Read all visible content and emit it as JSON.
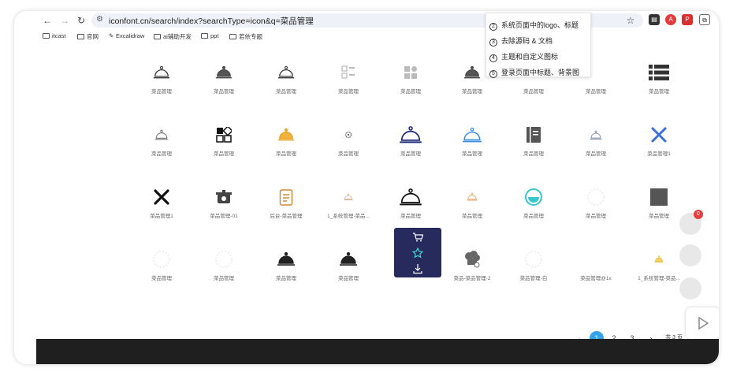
{
  "browser": {
    "url": "iconfont.cn/search/index?searchType=icon&q=菜品管理",
    "bookmarks": [
      "itcast",
      "官网",
      "Excalidraw",
      "ai辅助开发",
      "ppt",
      "若依专题"
    ]
  },
  "popup_menu": [
    {
      "num": "②",
      "label": "系统页面中的logo、标题"
    },
    {
      "num": "③",
      "label": "去除源码 & 文档"
    },
    {
      "num": "④",
      "label": "主题和自定义图标"
    },
    {
      "num": "⑤",
      "label": "登录页面中标题、背景图"
    }
  ],
  "icons": [
    {
      "label": "菜品管理",
      "icon": "cloche-outline-icon"
    },
    {
      "label": "菜品管理",
      "icon": "cloche-filled-icon"
    },
    {
      "label": "菜品管理",
      "icon": "cloche-outline-icon"
    },
    {
      "label": "菜品管理",
      "icon": "grid-list-icon"
    },
    {
      "label": "菜品管理",
      "icon": "grid-shapes-icon"
    },
    {
      "label": "菜品管理",
      "icon": "cloche-filled-icon"
    },
    {
      "label": "菜品管理",
      "icon": "hidden-icon"
    },
    {
      "label": "菜品管理",
      "icon": "hidden-icon"
    },
    {
      "label": "菜品管理",
      "icon": "list-icon"
    },
    {
      "label": "菜品管理",
      "icon": "cloche-thin-icon"
    },
    {
      "label": "菜品管理",
      "icon": "apps-icon"
    },
    {
      "label": "菜品管理",
      "icon": "cloche-yellow-icon"
    },
    {
      "label": "菜品管理",
      "icon": "gear-small-icon"
    },
    {
      "label": "菜品管理",
      "icon": "cloche-navy-icon"
    },
    {
      "label": "菜品管理",
      "icon": "cloche-blue-icon"
    },
    {
      "label": "菜品管理",
      "icon": "book-icon"
    },
    {
      "label": "菜品管理",
      "icon": "cloche-small-icon"
    },
    {
      "label": "菜品管理1",
      "icon": "fork-knife-blue-icon"
    },
    {
      "label": "菜品管理1",
      "icon": "fork-knife-icon"
    },
    {
      "label": "菜品管理-01",
      "icon": "pot-icon"
    },
    {
      "label": "后台-菜品管理",
      "icon": "clipboard-icon"
    },
    {
      "label": "1_系统管理-菜品...",
      "icon": "cloche-tiny-icon"
    },
    {
      "label": "菜品管理",
      "icon": "cloche-big-icon"
    },
    {
      "label": "菜品管理",
      "icon": "cloche-orange-outline-icon"
    },
    {
      "label": "菜品管理",
      "icon": "bowl-cyan-icon"
    },
    {
      "label": "菜品管理",
      "icon": "faded-icon"
    },
    {
      "label": "菜品管理",
      "icon": "square-icon"
    },
    {
      "label": "菜品管理",
      "icon": "faded-icon"
    },
    {
      "label": "菜品管理",
      "icon": "faded-icon"
    },
    {
      "label": "菜品管理",
      "icon": "cloche-solid-icon"
    },
    {
      "label": "菜品管理",
      "icon": "cloche-solid-icon"
    },
    {
      "label": "",
      "icon": "hover-card"
    },
    {
      "label": "菜品-菜品管理-2",
      "icon": "chef-icon"
    },
    {
      "label": "菜品管理-白",
      "icon": "faded-icon"
    },
    {
      "label": "菜品管理@1x",
      "icon": "blank-icon"
    },
    {
      "label": "1_系统管理-菜品...",
      "icon": "cloche-yellow-small-icon"
    }
  ],
  "hover_actions": [
    "cart-icon",
    "star-icon",
    "download-icon"
  ],
  "pagination": {
    "pages": [
      "1",
      "2",
      "3"
    ],
    "active": "1",
    "total_text": "共 3 页"
  },
  "notification_count": "0",
  "colors": {
    "accent": "#35a3ea",
    "card": "#262a5c",
    "footer": "#1f1f1f"
  }
}
